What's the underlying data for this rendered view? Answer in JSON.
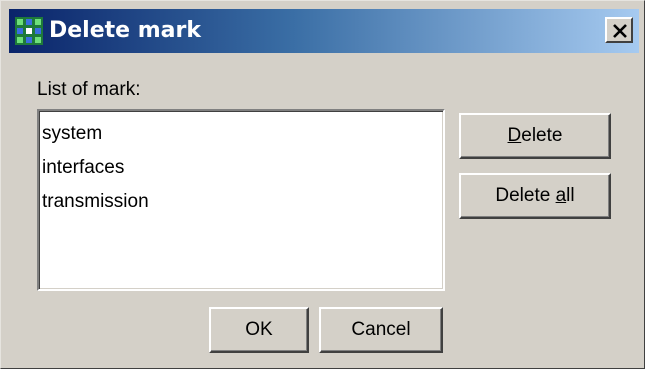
{
  "window": {
    "title": "Delete mark",
    "icon": "app-icon",
    "close_label": "close-icon"
  },
  "list": {
    "label": "List of mark:",
    "items": [
      "system",
      "interfaces",
      "transmission"
    ]
  },
  "buttons": {
    "delete": {
      "pre": "",
      "mnemonic": "D",
      "post": "elete"
    },
    "delete_all": {
      "pre": "Delete ",
      "mnemonic": "a",
      "post": "ll"
    },
    "ok": "OK",
    "cancel": "Cancel"
  }
}
